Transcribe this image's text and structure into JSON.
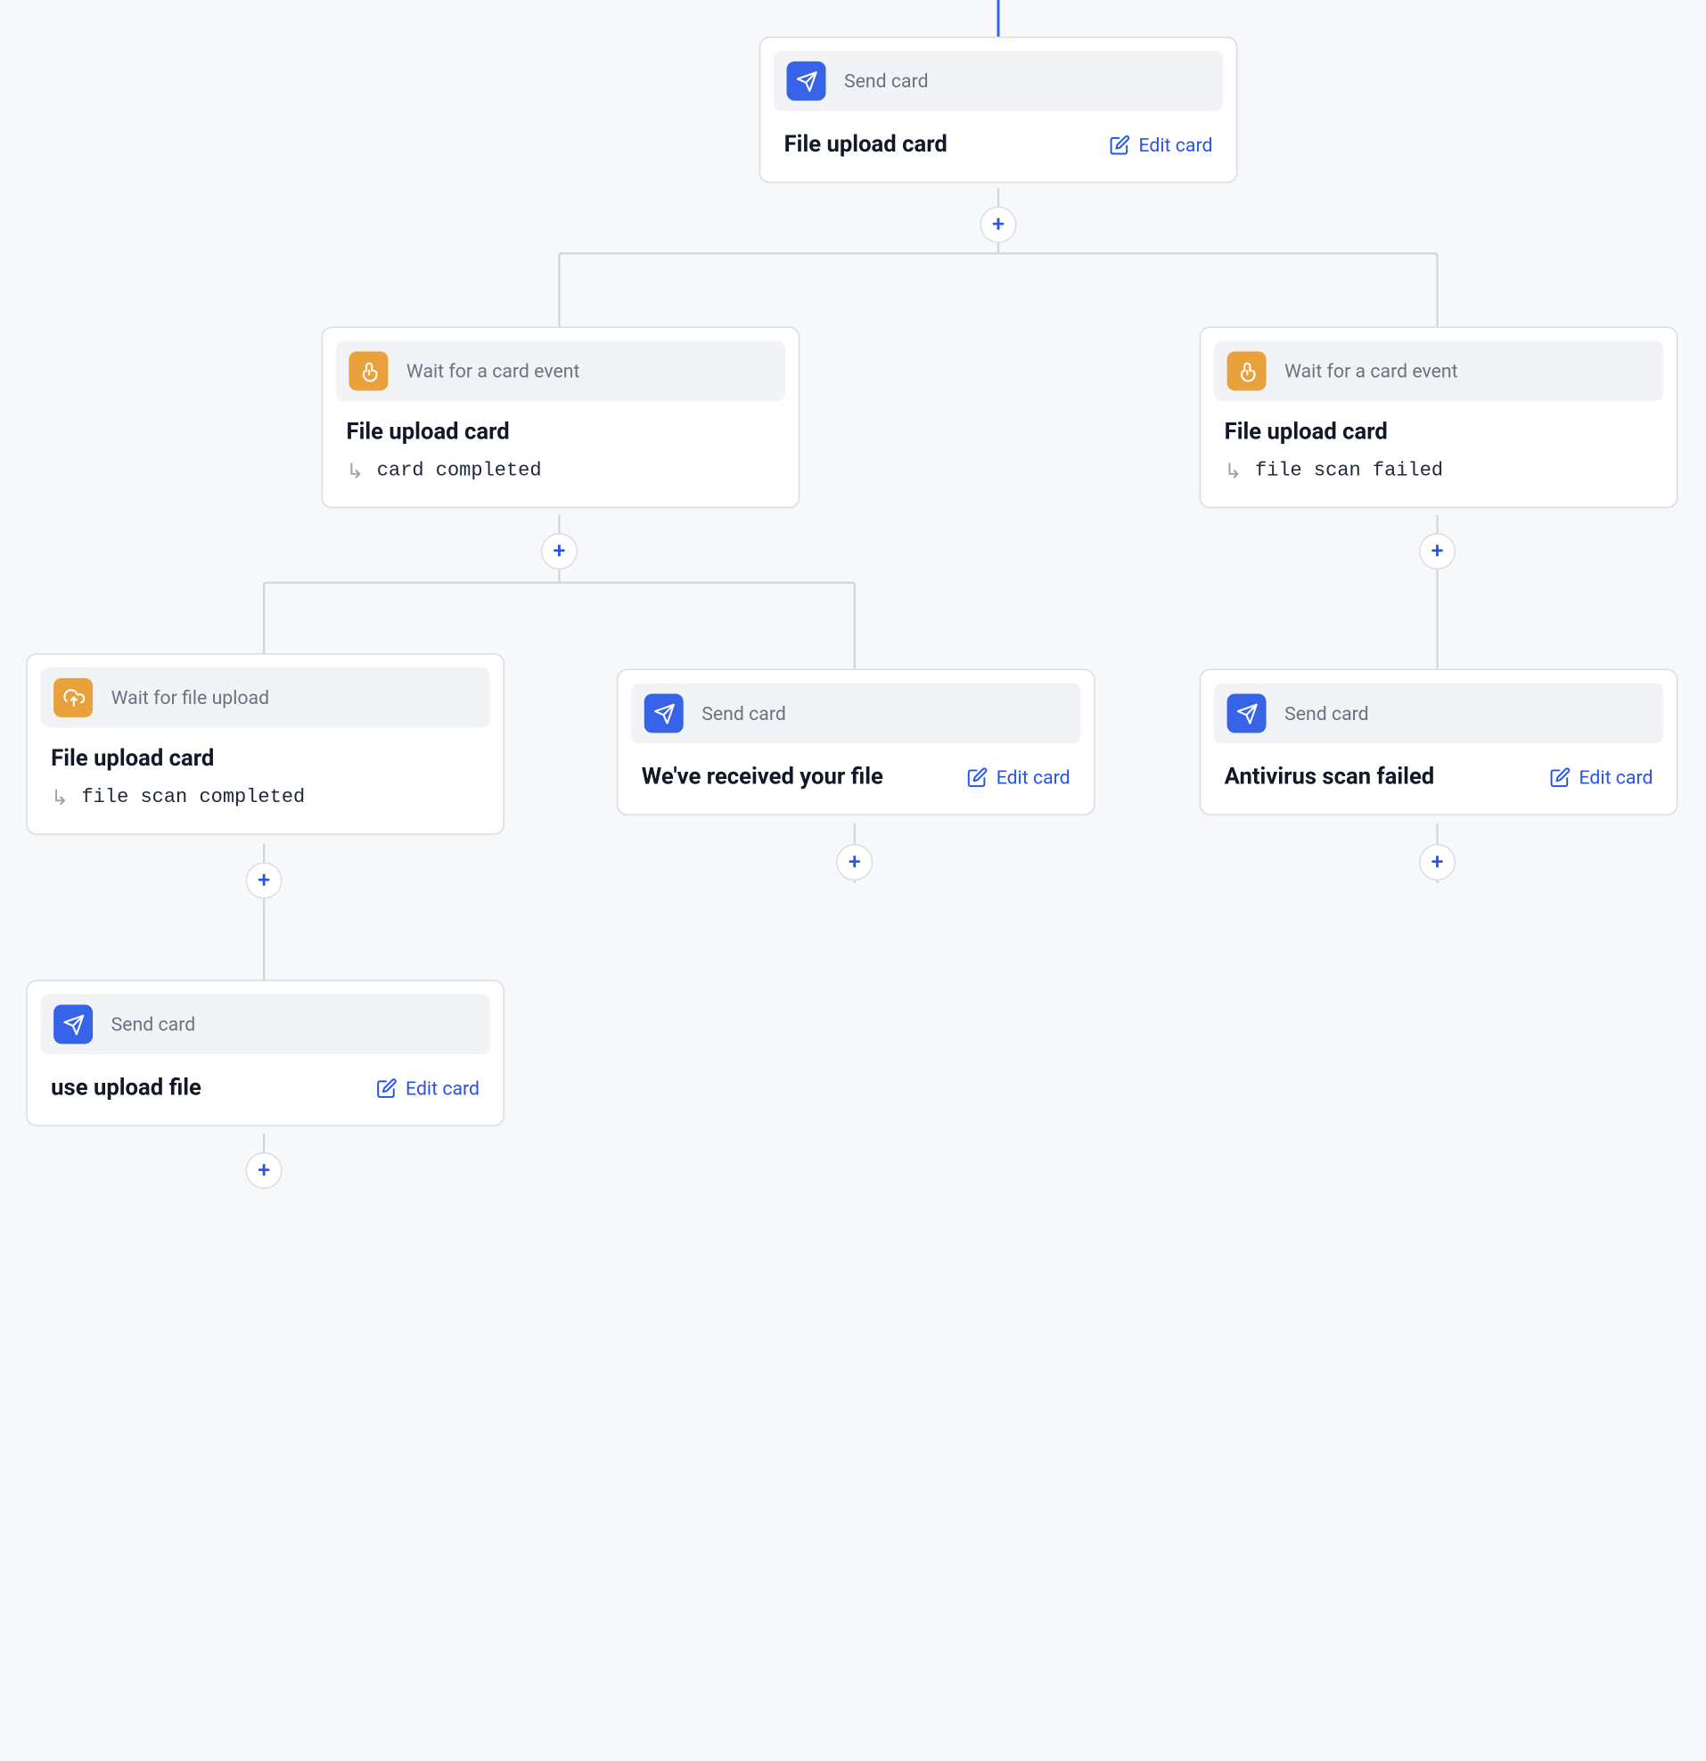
{
  "labels": {
    "send_card": "Send card",
    "wait_card_event": "Wait for a card event",
    "wait_file_upload": "Wait for file upload",
    "edit_card": "Edit card"
  },
  "nodes": {
    "root": {
      "type_label_key": "send_card",
      "title": "File upload card",
      "has_edit": true
    },
    "wait_completed": {
      "type_label_key": "wait_card_event",
      "title": "File upload card",
      "event": "card completed"
    },
    "wait_scan_failed": {
      "type_label_key": "wait_card_event",
      "title": "File upload card",
      "event": "file scan failed"
    },
    "wait_file_upload": {
      "type_label_key": "wait_file_upload",
      "title": "File upload card",
      "event": "file scan completed"
    },
    "send_received": {
      "type_label_key": "send_card",
      "title": "We've received your file",
      "has_edit": true
    },
    "send_av_failed": {
      "type_label_key": "send_card",
      "title": "Antivirus scan failed",
      "has_edit": true
    },
    "send_use_upload": {
      "type_label_key": "send_card",
      "title": "use upload file",
      "has_edit": true
    }
  }
}
